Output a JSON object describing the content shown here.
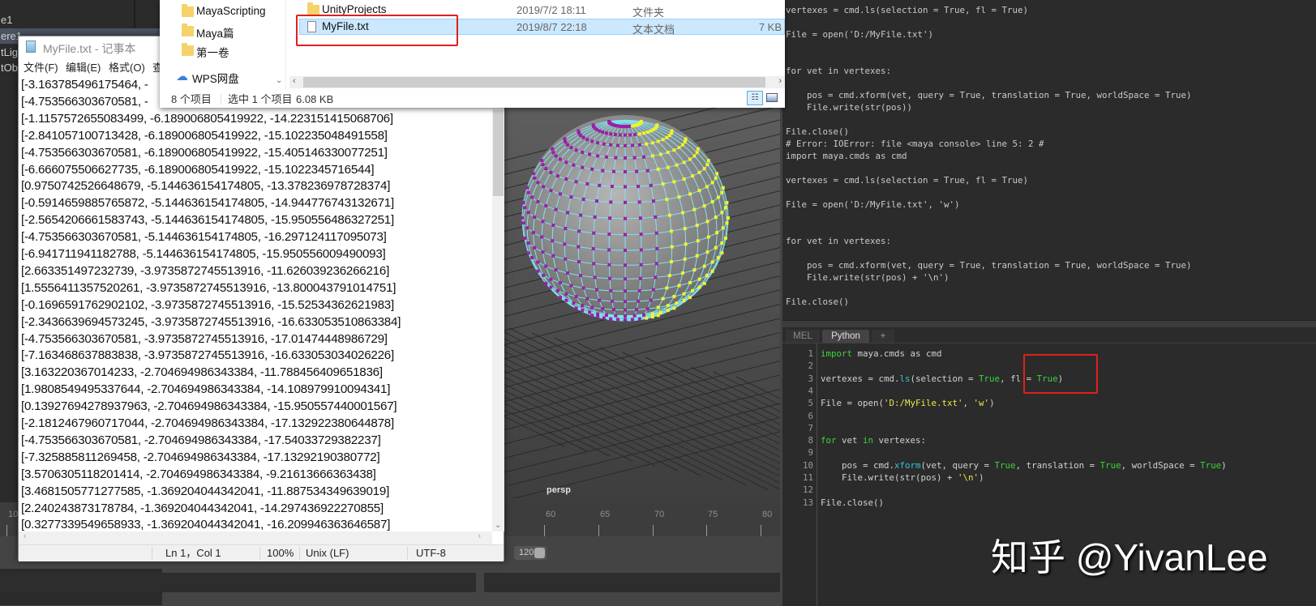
{
  "outliner": {
    "items": [
      "e1",
      "ere1",
      "tLig",
      "tOb"
    ],
    "selected_index": 1
  },
  "explorer": {
    "nav": [
      "MayaScripting",
      "Maya篇",
      "第一卷",
      "WPS网盘"
    ],
    "files": [
      {
        "name": "UnityProjects",
        "date": "2019/7/2 18:11",
        "type": "文件夹",
        "size": ""
      },
      {
        "name": "MyFile.txt",
        "date": "2019/8/7 22:18",
        "type": "文本文档",
        "size": "7 KB"
      }
    ],
    "status": {
      "count": "8 个项目",
      "selected": "选中 1 个项目",
      "size": "6.08 KB"
    }
  },
  "notepad": {
    "title": "MyFile.txt - 记事本",
    "menu": [
      "文件(F)",
      "编辑(E)",
      "格式(O)",
      "查"
    ],
    "lines": [
      "[-3.163785496175464, -",
      "[-4.753566303670581, -",
      "[-1.1157572655083499, -6.189006805419922, -14.223151415068706]",
      "[-2.841057100713428, -6.189006805419922, -15.102235048491558]",
      "[-4.753566303670581, -6.189006805419922, -15.405146330077251]",
      "[-6.666075506627735, -6.189006805419922, -15.1022345716544]",
      "[0.9750742526648679, -5.144636154174805, -13.378236978728374]",
      "[-0.5914659885765872, -5.144636154174805, -14.944776743132671]",
      "[-2.5654206661583743, -5.144636154174805, -15.950556486327251]",
      "[-4.753566303670581, -5.144636154174805, -16.297124117095073]",
      "[-6.941711941182788, -5.144636154174805, -15.950556009490093]",
      "[2.663351497232739, -3.9735872745513916, -11.626039236266216]",
      "[1.5556411357520261, -3.9735872745513916, -13.800043791014751]",
      "[-0.1696591762902102, -3.9735872745513916, -15.52534362621983]",
      "[-2.3436639694573245, -3.9735872745513916, -16.633053510863384]",
      "[-4.753566303670581, -3.9735872745513916, -17.01474448986729]",
      "[-7.163468637883838, -3.9735872745513916, -16.633053034026226]",
      "[3.163220367014233, -2.704694986343384, -11.788456409651836]",
      "[1.9808549495337644, -2.704694986343384, -14.108979910094341]",
      "[0.13927694278937963, -2.704694986343384, -15.950557440001567]",
      "[-2.1812467960717044, -2.704694986343384, -17.132922380644878]",
      "[-4.753566303670581, -2.704694986343384, -17.54033729382237]",
      "[-7.325885811269458, -2.704694986343384, -17.13292190380772]",
      "[3.5706305118201414, -2.704694986343384, -9.21613666363438]",
      "[3.4681505771277585, -1.369204044342041, -11.887534349639019]",
      "[2.240243873178784, -1.369204044342041, -14.297436922270855]",
      "[0.3277339549658933, -1.369204044342041, -16.209946363646587]"
    ],
    "status": {
      "position": "Ln 1，Col 1",
      "zoom": "100%",
      "eol": "Unix (LF)",
      "encoding": "UTF-8"
    }
  },
  "viewport": {
    "camera": "persp"
  },
  "timeline": {
    "ticks": [
      "10",
      "60",
      "65",
      "70",
      "75",
      "80"
    ],
    "end_frame": "120"
  },
  "script_editor": {
    "history": [
      "vertexes = cmd.ls(selection = True, fl = True)",
      "",
      "File = open('D:/MyFile.txt')",
      "",
      "",
      "for vet in vertexes:",
      "",
      "    pos = cmd.xform(vet, query = True, translation = True, worldSpace = True)",
      "    File.write(str(pos))",
      "",
      "File.close()",
      "# Error: IOError: file <maya console> line 5: 2 #",
      "import maya.cmds as cmd",
      "",
      "vertexes = cmd.ls(selection = True, fl = True)",
      "",
      "File = open('D:/MyFile.txt', 'w')",
      "",
      "",
      "for vet in vertexes:",
      "",
      "    pos = cmd.xform(vet, query = True, translation = True, worldSpace = True)",
      "    File.write(str(pos) + '\\n')",
      "",
      "File.close()"
    ],
    "tabs": [
      "MEL",
      "Python",
      "+"
    ],
    "active_tab": "Python",
    "code": [
      [
        [
          "import",
          "kw"
        ],
        [
          " maya.cmds as cmd",
          ""
        ]
      ],
      [],
      [
        [
          "vertexes = cmd.",
          ""
        ],
        [
          "ls",
          "fn"
        ],
        [
          "(selection = ",
          ""
        ],
        [
          "True",
          "kw"
        ],
        [
          ", fl = ",
          ""
        ],
        [
          "True",
          "kw"
        ],
        [
          ")",
          ""
        ]
      ],
      [],
      [
        [
          "File = open(",
          ""
        ],
        [
          "'D:/MyFile.txt'",
          "str"
        ],
        [
          ", ",
          ""
        ],
        [
          "'w'",
          "str"
        ],
        [
          ")",
          ""
        ]
      ],
      [],
      [],
      [
        [
          "for",
          "kw"
        ],
        [
          " vet ",
          ""
        ],
        [
          "in",
          "kw"
        ],
        [
          " vertexes:",
          ""
        ]
      ],
      [],
      [
        [
          "    pos = cmd.",
          ""
        ],
        [
          "xform",
          "fn"
        ],
        [
          "(vet, query = ",
          ""
        ],
        [
          "True",
          "kw"
        ],
        [
          ", translation = ",
          ""
        ],
        [
          "True",
          "kw"
        ],
        [
          ", worldSpace = ",
          ""
        ],
        [
          "True",
          "kw"
        ],
        [
          ")",
          ""
        ]
      ],
      [
        [
          "    File.write(str(pos) + ",
          ""
        ],
        [
          "'\\n'",
          "str"
        ],
        [
          ")",
          ""
        ]
      ],
      [],
      [
        [
          "File.close()",
          ""
        ]
      ]
    ]
  },
  "watermark": "知乎 @YivanLee",
  "colors": {
    "highlight_box": "#e0201c",
    "selection_row": "#cce8ff",
    "keyword": "#3ad43a",
    "function": "#35c4d6",
    "string": "#e8e84a"
  }
}
